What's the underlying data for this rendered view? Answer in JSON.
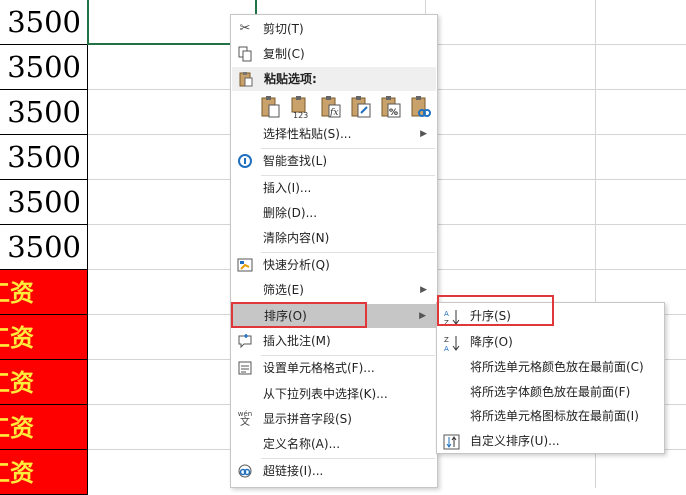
{
  "sheet": {
    "number_cells": [
      "3500",
      "3500",
      "3500",
      "3500",
      "3500",
      "3500"
    ],
    "red_cells": [
      "工资",
      "工资",
      "工资",
      "工资",
      "工资"
    ],
    "red_color": "#ff0000",
    "text_yellow": "#ffeb3b",
    "selection_color": "#217346"
  },
  "menu": {
    "cut": "剪切(T)",
    "copy": "复制(C)",
    "paste_options": "粘贴选项:",
    "paste_special": "选择性粘贴(S)...",
    "smart_lookup": "智能查找(L)",
    "insert": "插入(I)...",
    "delete": "删除(D)...",
    "clear_contents": "清除内容(N)",
    "quick_analysis": "快速分析(Q)",
    "filter": "筛选(E)",
    "sort": "排序(O)",
    "insert_comment": "插入批注(M)",
    "format_cells": "设置单元格格式(F)...",
    "pick_from_list": "从下拉列表中选择(K)...",
    "phonetic": "显示拼音字段(S)",
    "define_name": "定义名称(A)...",
    "hyperlink": "超链接(I)...",
    "phonetic_icon_text": "wén",
    "phonetic_icon_char": "文"
  },
  "submenu": {
    "ascending": "升序(S)",
    "descending": "降序(O)",
    "cell_color_top": "将所选单元格颜色放在最前面(C)",
    "font_color_top": "将所选字体颜色放在最前面(F)",
    "cell_icon_top": "将所选单元格图标放在最前面(I)",
    "custom_sort": "自定义排序(U)..."
  },
  "highlight_color": "#e0373a"
}
